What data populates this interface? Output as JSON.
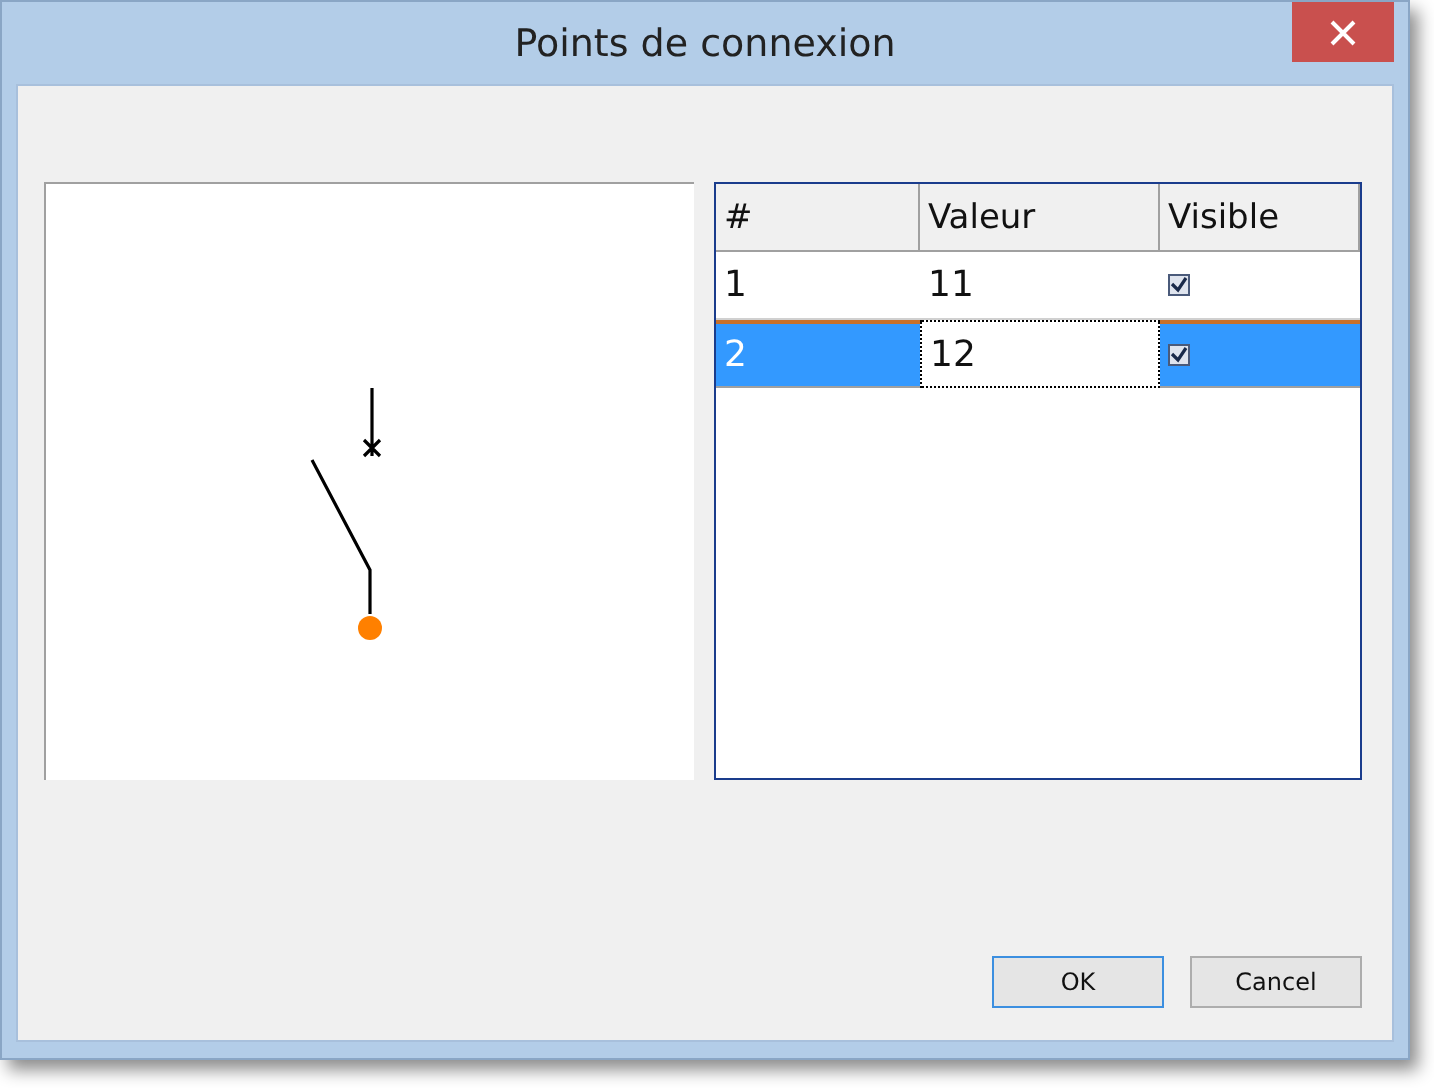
{
  "window": {
    "title": "Points de connexion"
  },
  "table": {
    "columns": [
      "#",
      "Valeur",
      "Visible"
    ],
    "rows": [
      {
        "number": "1",
        "value": "11",
        "visible": true,
        "selected": false
      },
      {
        "number": "2",
        "value": "12",
        "visible": true,
        "selected": true
      }
    ]
  },
  "buttons": [
    {
      "label": "OK",
      "default": true
    },
    {
      "label": "Cancel",
      "default": false
    }
  ]
}
